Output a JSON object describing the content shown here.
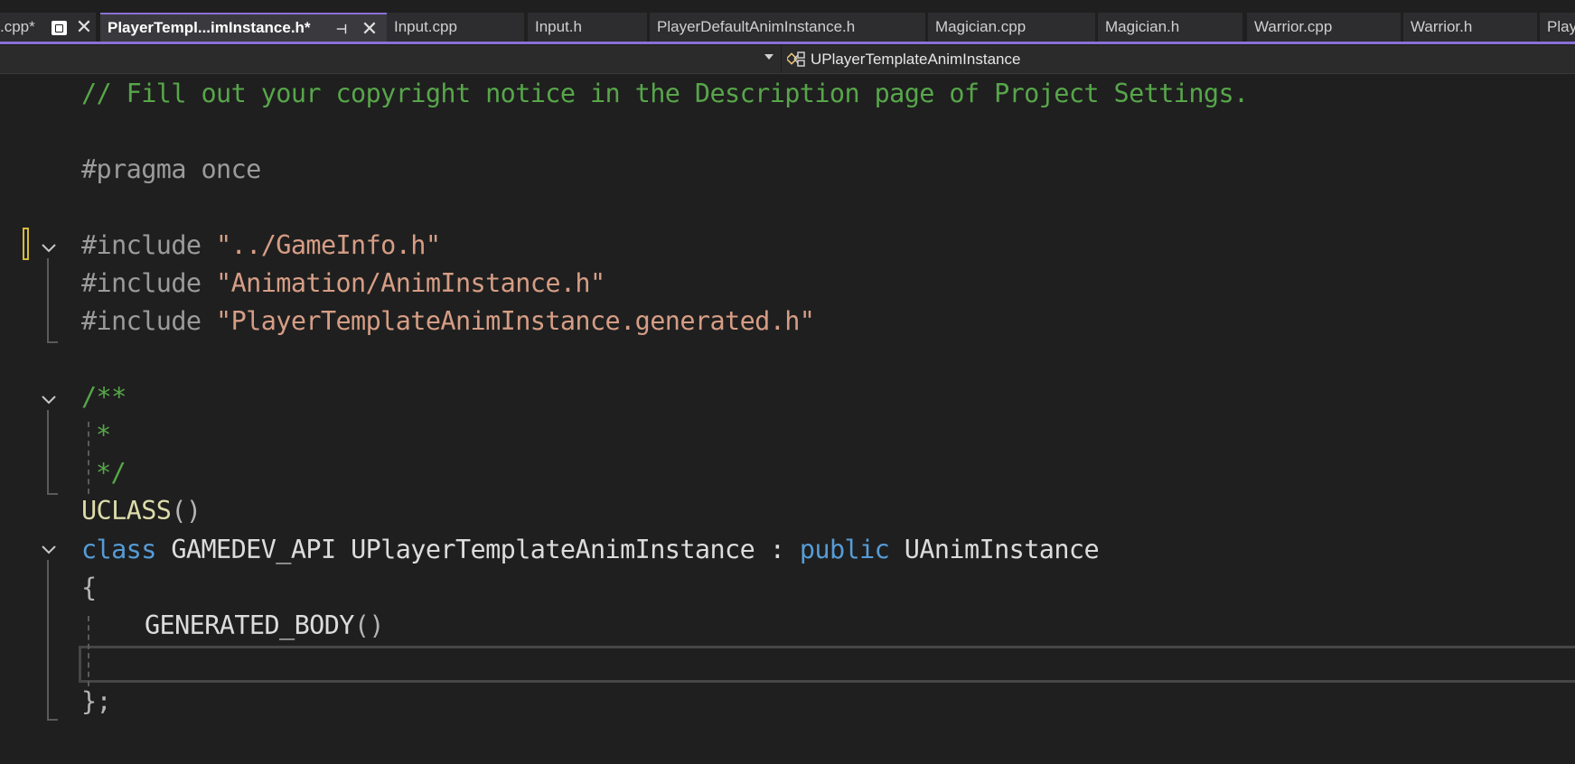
{
  "tabs": [
    {
      "label": ".cpp*",
      "active": false
    },
    {
      "label": "PlayerTempl...imInstance.h*",
      "active": true
    },
    {
      "label": "Input.cpp",
      "active": false
    },
    {
      "label": "Input.h",
      "active": false
    },
    {
      "label": "PlayerDefaultAnimInstance.h",
      "active": false
    },
    {
      "label": "Magician.cpp",
      "active": false
    },
    {
      "label": "Magician.h",
      "active": false
    },
    {
      "label": "Warrior.cpp",
      "active": false
    },
    {
      "label": "Warrior.h",
      "active": false
    },
    {
      "label": "Play",
      "active": false
    }
  ],
  "navbar": {
    "scope": "UPlayerTemplateAnimInstance"
  },
  "code": {
    "l1_comment": "// Fill out your copyright notice in the Description page of Project Settings.",
    "l3_pragma": "#pragma once",
    "l5_include": "#include ",
    "l5_str": "\"../GameInfo.h\"",
    "l6_include": "#include ",
    "l6_str": "\"Animation/AnimInstance.h\"",
    "l7_include": "#include ",
    "l7_str": "\"PlayerTemplateAnimInstance.generated.h\"",
    "l9_comment": "/**",
    "l10_comment": "*",
    "l11_comment": "*/",
    "l12_macro": "UCLASS",
    "l12_parens": "()",
    "l13_kw_class": "class",
    "l13_api": " GAMEDEV_API ",
    "l13_name": "UPlayerTemplateAnimInstance",
    "l13_colon": " : ",
    "l13_kw_public": "public",
    "l13_base": " UAnimInstance",
    "l14_brace": "{",
    "l15_macro": "GENERATED_BODY",
    "l15_parens": "()",
    "l17_close": "};"
  },
  "colors": {
    "accent": "#8a70d6",
    "comment": "#57a64a",
    "string": "#d69d85",
    "keyword": "#569cd6",
    "macro": "#dcdcaa",
    "change_marker": "#d7ba3b"
  },
  "icons": {
    "tab_pin": "pin-icon",
    "tab_close": "close-icon",
    "nav_dropdown": "chevron-down-icon",
    "scope": "class-icon",
    "fold": "chevron-down-icon"
  }
}
